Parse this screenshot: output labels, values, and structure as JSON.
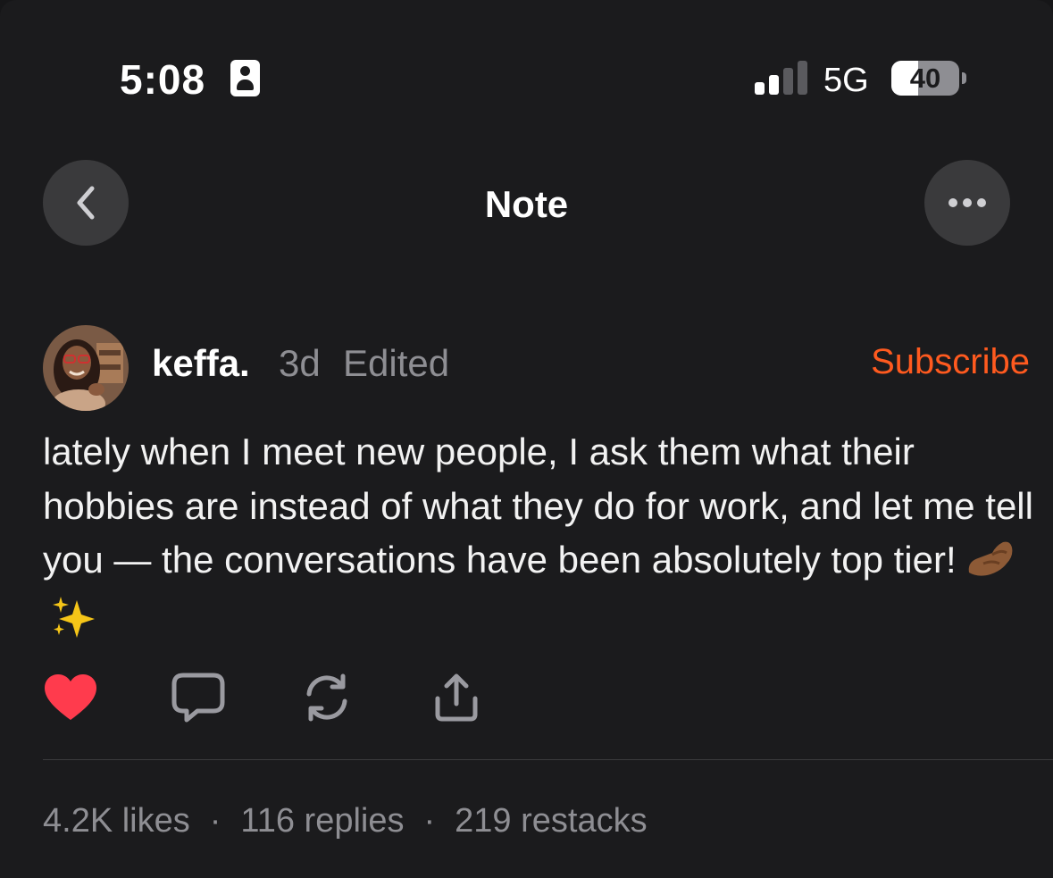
{
  "status_bar": {
    "time": "5:08",
    "network": "5G",
    "battery": "40",
    "battery_level": 0.4,
    "signal_bars": 2,
    "signal_total": 4
  },
  "nav": {
    "title": "Note",
    "back_icon": "chevron-left-icon",
    "more_icon": "ellipsis-icon"
  },
  "post": {
    "author": "keffa.",
    "time": "3d",
    "edited": "Edited",
    "subscribe": "Subscribe",
    "body": "lately when I meet new people, I ask them what their hobbies are instead of what they do for work, and let me tell you — the conversations have been absolutely top tier!",
    "emojis": [
      "pinched-fingers-emoji",
      "sparkles-emoji"
    ]
  },
  "actions": {
    "like_icon": "heart-icon",
    "liked": true,
    "reply_icon": "speech-bubble-icon",
    "restack_icon": "restack-icon",
    "share_icon": "share-icon"
  },
  "stats": {
    "likes": "4.2K likes",
    "separator": "·",
    "replies": "116 replies",
    "restacks": "219 restacks"
  },
  "colors": {
    "background": "#1b1b1d",
    "accent": "#ff5a1f",
    "like": "#ff3b4d",
    "muted": "#8e8e93"
  }
}
